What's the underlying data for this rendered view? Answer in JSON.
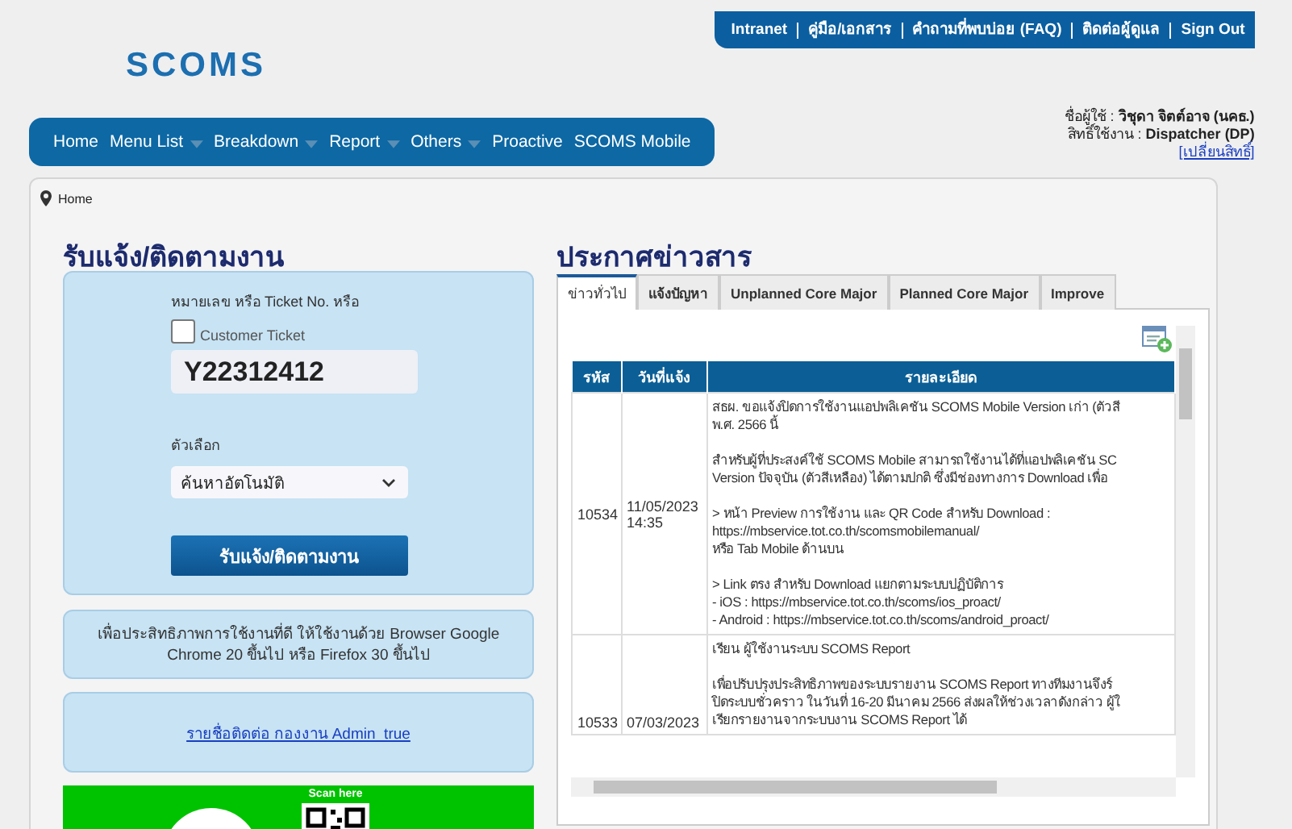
{
  "top_links": [
    "Intranet",
    "คู่มือ/เอกสาร",
    "คำถามที่พบบ่อย (FAQ)",
    "ติดต่อผู้ดูแล",
    "Sign Out"
  ],
  "logo": "SCOMS",
  "nav": [
    {
      "label": "Home",
      "dropdown": false
    },
    {
      "label": "Menu List",
      "dropdown": true
    },
    {
      "label": "Breakdown",
      "dropdown": true
    },
    {
      "label": "Report",
      "dropdown": true
    },
    {
      "label": "Others",
      "dropdown": true
    },
    {
      "label": "Proactive",
      "dropdown": false
    },
    {
      "label": "SCOMS Mobile",
      "dropdown": false
    }
  ],
  "user": {
    "name_label": "ชื่อผู้ใช้ :",
    "name": "วิชุดา จิตต์อาจ (นคธ.)",
    "role_label": "สิทธิ์ใช้งาน :",
    "role": "Dispatcher (DP)",
    "change_link": "[เปลี่ยนสิทธิ์]"
  },
  "breadcrumb": "Home",
  "ticket_panel": {
    "title": "รับแจ้ง/ติดตามงาน",
    "field_label": "หมายเลข หรือ Ticket No. หรือ",
    "customer_ticket": {
      "label": "Customer Ticket",
      "checked": false
    },
    "ticket_value": "Y22312412",
    "option_label": "ตัวเลือก",
    "option_value": "ค้นหาอัตโนมัติ",
    "button": "รับแจ้ง/ติดตามงาน"
  },
  "browser_note": "เพื่อประสิทธิภาพการใช้งานที่ดี ให้ใช้งานด้วย Browser Google Chrome 20 ขึ้นไป หรือ Firefox 30 ขึ้นไป",
  "contact_link": "รายชื่อติดต่อ กองงาน Admin_true",
  "qr_banner": {
    "caption": "Scan here"
  },
  "news": {
    "title": "ประกาศข่าวสาร",
    "tabs": [
      {
        "label": "ข่าวทั่วไป",
        "selected": true
      },
      {
        "label": "แจ้งปัญหา",
        "selected": false
      },
      {
        "label": "Unplanned Core Major",
        "selected": false
      },
      {
        "label": "Planned Core Major",
        "selected": false
      },
      {
        "label": "Improve",
        "selected": false
      }
    ],
    "columns": [
      "รหัส",
      "วันที่แจ้ง",
      "รายละเอียด"
    ],
    "rows": [
      {
        "id": "10534",
        "date": "11/05/2023 14:35",
        "details": [
          [
            "สธผ. ขอแจ้งปิดการใช้งานแอปพลิเคชัน SCOMS Mobile Version เก่า (ตัวสี",
            "พ.ศ. 2566 นี้"
          ],
          [
            "สำหรับผู้ที่ประสงค์ใช้ SCOMS Mobile สามารถใช้งานได้ที่แอปพลิเคชัน SC",
            "Version ปัจจุบัน (ตัวสีเหลือง) ได้ตามปกติ ซึ่งมีช่องทางการ Download เพื่อ"
          ],
          [
            "> หน้า Preview การใช้งาน และ QR Code สำหรับ Download :",
            "https://mbservice.tot.co.th/scomsmobilemanual/",
            "หรือ Tab Mobile ด้านบน"
          ],
          [
            "> Link ตรง สำหรับ Download แยกตามระบบปฏิบัติการ",
            "- iOS : https://mbservice.tot.co.th/scoms/ios_proact/",
            "- Android : https://mbservice.tot.co.th/scoms/android_proact/"
          ]
        ]
      },
      {
        "id": "10533",
        "date": "07/03/2023",
        "details": [
          [
            "เรียน ผู้ใช้งานระบบ SCOMS Report"
          ],
          [
            "เพื่อปรับปรุงประสิทธิภาพของระบบรายงาน SCOMS Report  ทางทีมงานจึงร์",
            "ปิดระบบชั่วคราว ในวันที่ 16-20 มีนาคม 2566 ส่งผลให้ช่วงเวลาดังกล่าว ผู้ใ",
            "เรียกรายงานจากระบบงาน SCOMS Report ได้"
          ]
        ]
      }
    ]
  }
}
